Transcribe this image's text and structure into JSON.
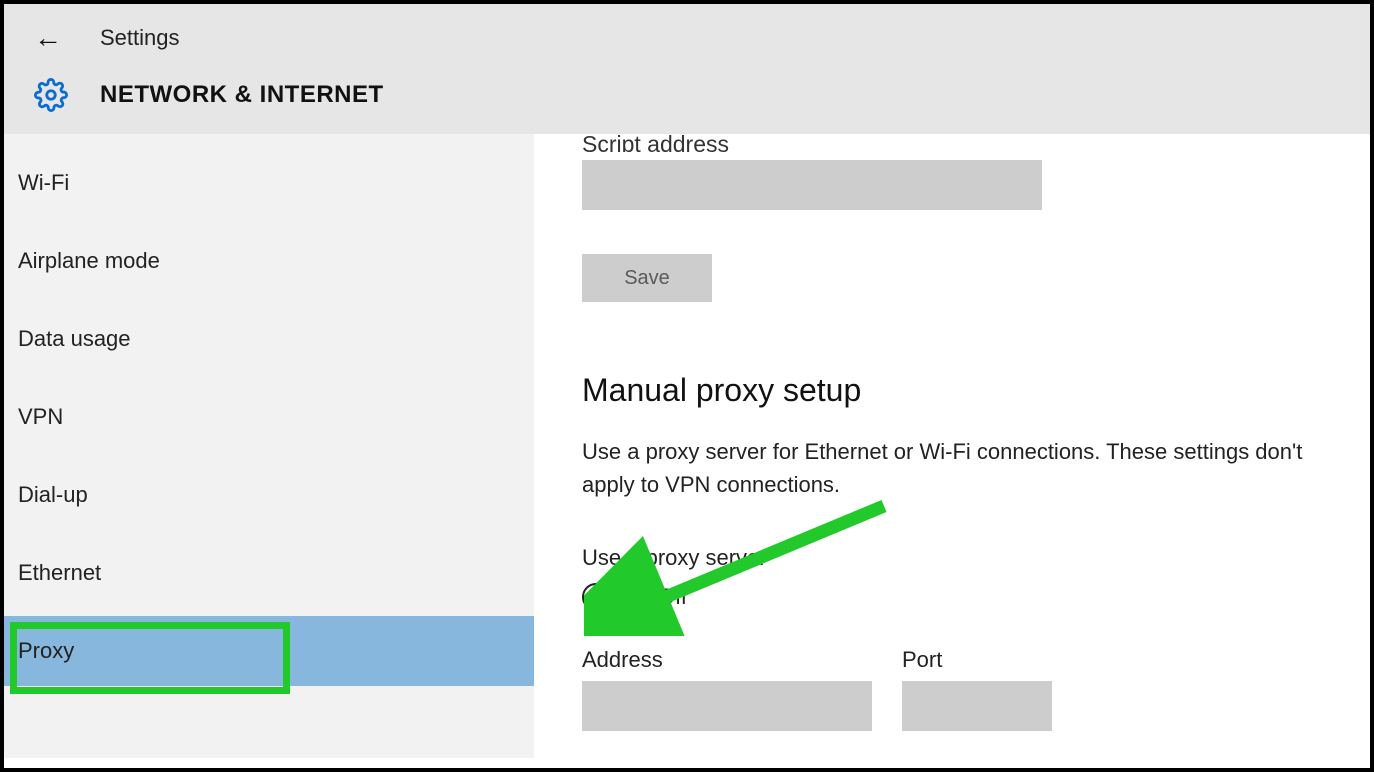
{
  "header": {
    "back": "←",
    "title": "Settings"
  },
  "subheader": {
    "title": "NETWORK & INTERNET"
  },
  "sidebar": {
    "items": [
      {
        "label": "Wi-Fi"
      },
      {
        "label": "Airplane mode"
      },
      {
        "label": "Data usage"
      },
      {
        "label": "VPN"
      },
      {
        "label": "Dial-up"
      },
      {
        "label": "Ethernet"
      },
      {
        "label": "Proxy"
      }
    ]
  },
  "main": {
    "script_address_label_partial": "Script address",
    "save_button": "Save",
    "manual_title": "Manual proxy setup",
    "manual_desc": "Use a proxy server for Ethernet or Wi-Fi connections. These settings don't apply to VPN connections.",
    "use_proxy_label": "Use a proxy server",
    "toggle_state": "Off",
    "address_label": "Address",
    "port_label": "Port"
  }
}
